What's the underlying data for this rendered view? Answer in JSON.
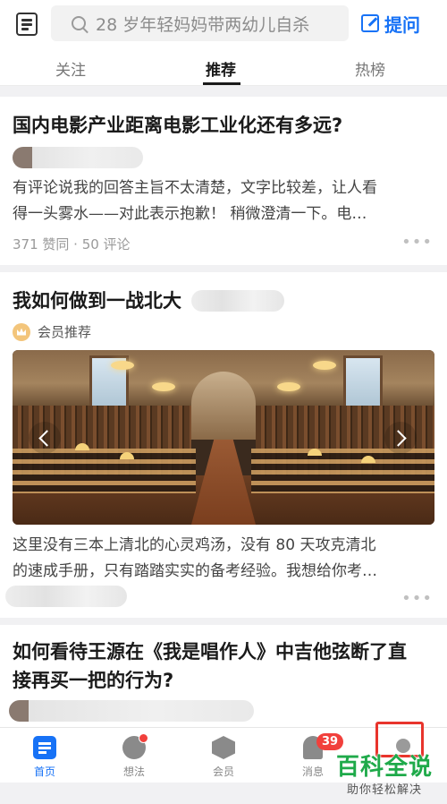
{
  "header": {
    "search_placeholder": "28 岁年轻妈妈带两幼儿自杀",
    "ask_label": "提问"
  },
  "tabs": [
    {
      "label": "关注"
    },
    {
      "label": "推荐",
      "active": true
    },
    {
      "label": "热榜"
    }
  ],
  "feed": [
    {
      "title": "国内电影产业距离电影工业化还有多远?",
      "excerpt_line1": "有评论说我的回答主旨不太清楚，文字比较差，让人看",
      "excerpt_line2": "得一头雾水——对此表示抱歉！ 稍微澄清一下。电…",
      "stats": "371 赞同 · 50 评论",
      "more": "•••"
    },
    {
      "title": "我如何做到一战北大",
      "tag": "会员推荐",
      "excerpt_line1": "这里没有三本上清北的心灵鸡汤，没有 80 天攻克清北",
      "excerpt_line2": "的速成手册，只有踏踏实实的备考经验。我想给你考…",
      "more": "•••"
    },
    {
      "title_line1": "如何看待王源在《我是唱作人》中吉他弦断了直",
      "title_line2": "接再买一把的行为?"
    }
  ],
  "bottom_nav": {
    "items": [
      {
        "label": "首页",
        "icon": "home-icon",
        "active": true
      },
      {
        "label": "想法",
        "icon": "idea-icon",
        "dot": true
      },
      {
        "label": "会员",
        "icon": "member-icon"
      },
      {
        "label": "消息",
        "icon": "bell-icon",
        "badge": "39"
      },
      {
        "label": "我的",
        "icon": "profile-icon"
      }
    ]
  },
  "watermark": {
    "title": "百科全说",
    "subtitle": "助你轻松解决"
  },
  "colors": {
    "accent": "#1772f6",
    "badge_red": "#f1403c",
    "highlight": "#e8342c",
    "watermark_green": "#1faa4a"
  }
}
